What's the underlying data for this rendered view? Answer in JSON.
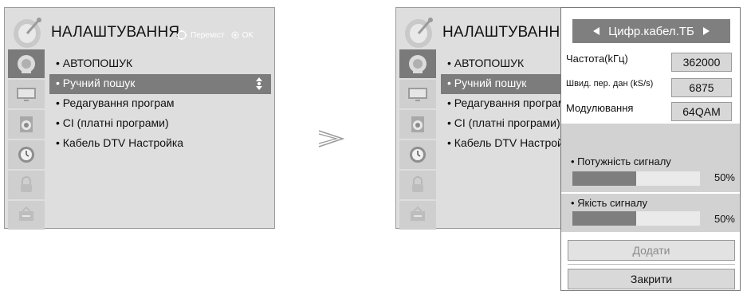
{
  "left_screen": {
    "title": "НАЛАШТУВАННЯ",
    "hints": {
      "move": "Переміст",
      "ok": "OK"
    },
    "menu": [
      "• АВТОПОШУК",
      "• Ручний пошук",
      "• Редагування програм",
      "• CI (платні програми)",
      "• Кабель DTV Настройка"
    ]
  },
  "right_screen": {
    "title": "НАЛАШТУВАННЯ",
    "menu": [
      "• АВТОПОШУК",
      "• Ручний пошук",
      "• Редагування програм",
      "• CI (платні програми)",
      "• Кабель DTV Настройка"
    ]
  },
  "popup": {
    "header": "Цифр.кабел.ТБ",
    "fields": {
      "frequency_label": "Частота(kГц)",
      "frequency_value": "362000",
      "symbol_rate_label": "Швид. пер. дан (kS/s)",
      "symbol_rate_value": "6875",
      "modulation_label": "Модулювання",
      "modulation_value": "64QAM"
    },
    "signal_strength": {
      "label": "• Потужність сигналу",
      "percent_text": "50%",
      "level": 0.5
    },
    "signal_quality": {
      "label": "• Якість сигналу",
      "percent_text": "50%",
      "level": 0.5
    },
    "add_button": "Додати",
    "close_button": "Закрити"
  },
  "colors": {
    "panel": "#dedede",
    "selected": "#7c7c7c",
    "header": "#7f7f7f"
  },
  "icons": [
    "satellite-dish-icon",
    "tv-screen-icon",
    "speaker-icon",
    "clock-icon",
    "lock-icon",
    "settings-box-icon",
    "move-arrows-icon",
    "ok-icon",
    "up-down-icon",
    "next-arrow-icon",
    "left-triangle-icon",
    "right-triangle-icon"
  ]
}
